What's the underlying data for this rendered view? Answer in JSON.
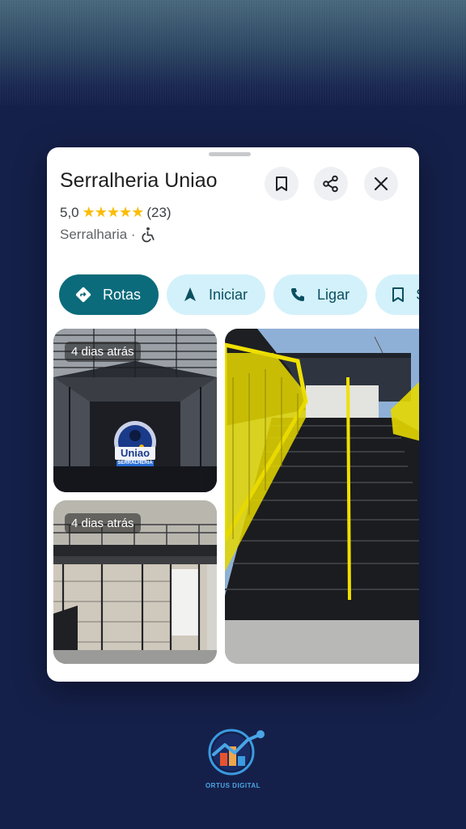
{
  "place": {
    "name": "Serralheria Uniao",
    "rating": "5,0",
    "stars": "★★★★★",
    "review_count": "(23)",
    "category": "Serralharia ·"
  },
  "actions": [
    {
      "label": "Rotas",
      "icon": "directions-icon"
    },
    {
      "label": "Iniciar",
      "icon": "navigation-arrow-icon"
    },
    {
      "label": "Ligar",
      "icon": "phone-icon"
    },
    {
      "label": "S",
      "icon": "bookmark-icon"
    }
  ],
  "photos": {
    "warehouse_badge": "4 dias atrás",
    "mezzanine_badge": "4 dias atrás",
    "logo_text_main": "Uniao",
    "logo_text_sub": "SERRALHERIA"
  },
  "brand": {
    "name": "ORTUS DIGITAL"
  },
  "colors": {
    "background": "#15204a",
    "primary_chip": "#0b6b7b",
    "chip": "#d3f1fb",
    "star": "#fbbc04"
  }
}
